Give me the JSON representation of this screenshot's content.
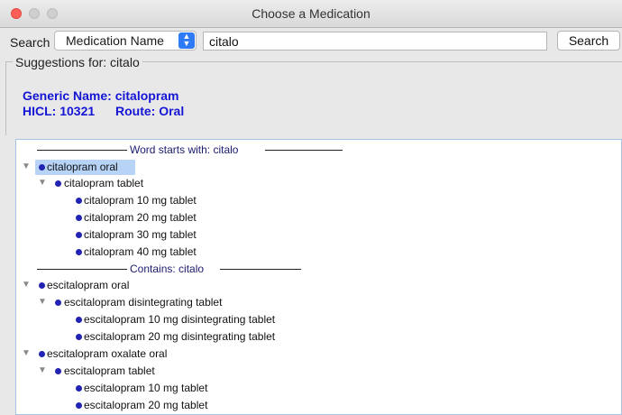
{
  "window": {
    "title": "Choose a Medication"
  },
  "search": {
    "label": "Search",
    "type_selected": "Medication Name",
    "query": "citalo",
    "button_label": "Search"
  },
  "suggestions": {
    "title": "Suggestions for: citalo",
    "generic_name": "Generic Name: citalopram",
    "hicl": "HICL: 10321",
    "route": "Route: Oral"
  },
  "tree": {
    "section_starts": "Word starts with: citalo",
    "section_contains": "Contains: citalo",
    "items": [
      "citalopram oral",
      "citalopram tablet",
      "citalopram 10 mg tablet",
      "citalopram 20 mg tablet",
      "citalopram 30 mg tablet",
      "citalopram 40 mg tablet",
      "escitalopram oral",
      "escitalopram disintegrating tablet",
      "escitalopram 10 mg disintegrating tablet",
      "escitalopram 20 mg disintegrating tablet",
      "escitalopram oxalate oral",
      "escitalopram tablet",
      "escitalopram 10 mg tablet",
      "escitalopram 20 mg tablet"
    ]
  },
  "colors": {
    "accent": "#2f7bf5",
    "generic_text": "#1515d6",
    "selection": "#b7d3f6",
    "bullet": "#2323b3"
  }
}
